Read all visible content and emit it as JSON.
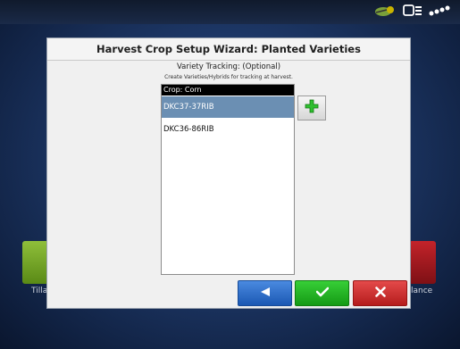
{
  "dialog": {
    "title": "Harvest Crop Setup Wizard:  Planted Varieties",
    "subtitle": "Variety Tracking: (Optional)",
    "hint": "Create Varieties/Hybrids for tracking at harvest."
  },
  "varieties": {
    "header": "Crop: Corn",
    "items": [
      "DKC37-37RIB",
      "DKC36-86RIB"
    ],
    "selected": "DKC37-37RIB"
  },
  "background": {
    "left_tile_label": "Tilla",
    "right_tile_label": "lance"
  },
  "icons": {
    "add": "plus-icon",
    "back": "left-arrow-icon",
    "ok": "checkmark-icon",
    "cancel": "x-icon"
  },
  "colors": {
    "back": "#1b58b3",
    "ok": "#159a15",
    "cancel": "#b51c1c",
    "selected_row": "#6b8fb3"
  }
}
